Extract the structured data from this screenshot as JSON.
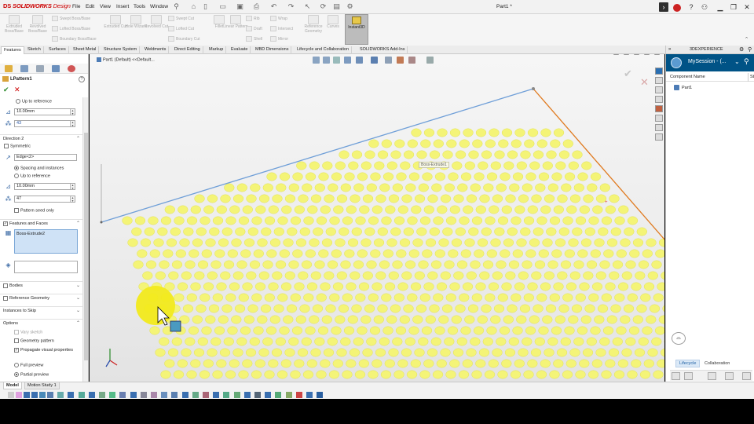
{
  "app": {
    "logo_prefix": "DS",
    "logo_name": "SOLIDWORKS",
    "logo_suffix": "Design",
    "menu": [
      "File",
      "Edit",
      "View",
      "Insert",
      "Tools",
      "Window"
    ],
    "doc_title": "Part1 *"
  },
  "ribbon": {
    "big_tools": [
      {
        "label": "Extruded Boss/Base"
      },
      {
        "label": "Revolved Boss/Base"
      },
      {
        "label": "Extruded Cut"
      },
      {
        "label": "Hole Wizard"
      },
      {
        "label": "Revolved Cut"
      },
      {
        "label": "Fillet"
      },
      {
        "label": "Linear Pattern"
      },
      {
        "label": "Reference Geometry"
      },
      {
        "label": "Curves"
      }
    ],
    "small_tools": [
      "Swept Boss/Base",
      "Lofted Boss/Base",
      "Boundary Boss/Base",
      "Swept Cut",
      "Lofted Cut",
      "Boundary Cut",
      "Rib",
      "Draft",
      "Shell",
      "Wrap",
      "Intersect",
      "Mirror"
    ],
    "instant3d": "Instant3D"
  },
  "tabs": [
    "Features",
    "Sketch",
    "Surfaces",
    "Sheet Metal",
    "Structure System",
    "Weldments",
    "Direct Editing",
    "Markup",
    "Evaluate",
    "MBD Dimensions",
    "Lifecycle and Collaboration",
    "SOLIDWORKS Add-Ins"
  ],
  "property_manager": {
    "title": "LPattern1",
    "up_to_reference_1": "Up to reference",
    "spacing_1": "10.00mm",
    "instances_1": "43",
    "direction2_title": "Direction 2",
    "symmetric": "Symmetric",
    "direction2_edge": "Edge<2>",
    "spacing_and_instances": "Spacing and instances",
    "up_to_reference_2": "Up to reference",
    "spacing_2": "10.00mm",
    "instances_2": "47",
    "pattern_seed_only": "Pattern seed only",
    "features_and_faces": "Features and Faces",
    "selected_feature": "Boss-Extrude2",
    "bodies": "Bodies",
    "reference_geometry": "Reference Geometry",
    "instances_to_skip": "Instances to Skip",
    "options": "Options",
    "vary_sketch": "Vary sketch",
    "geometry_pattern": "Geometry pattern",
    "propagate_visual": "Propagate visual properties",
    "full_preview": "Full preview",
    "partial_preview": "Partial preview"
  },
  "viewport": {
    "tree_label": "Part1 (Default) <<Default...",
    "tooltip": "Boss-Extrude1"
  },
  "taskpane": {
    "header": "3DEXPERIENCE",
    "session": "MySession - (...",
    "col_component": "Component Name",
    "col_status": "St",
    "part": "Part1",
    "tab_lifecycle": "Lifecycle",
    "tab_collaboration": "Collaboration"
  },
  "statusbar": {
    "tab_model": "Model",
    "tab_motion": "Motion Study 1"
  },
  "colors": {
    "accent_red": "#cc0000",
    "session_blue": "#005386",
    "pattern_yellow": "#f4f477",
    "edge_blue": "#6f9fd8",
    "edge_orange": "#e07a1f",
    "highlight_yellow": "#f2ea1c"
  }
}
